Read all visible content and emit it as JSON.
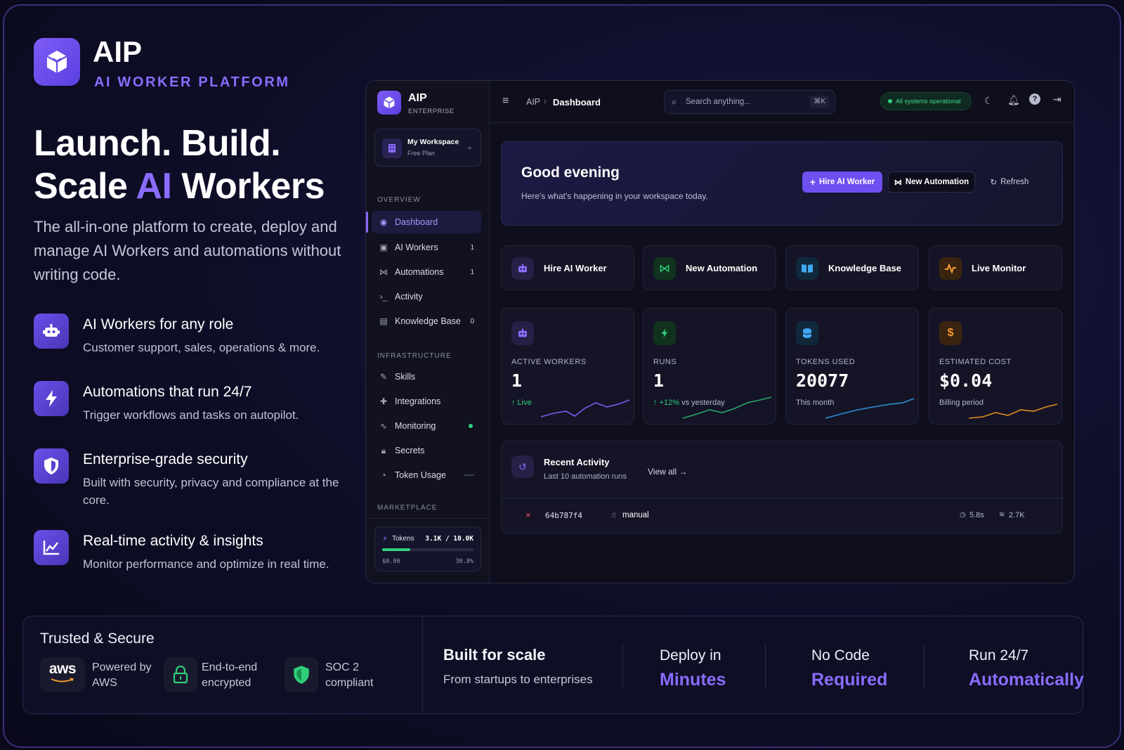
{
  "brand": {
    "name": "AIP",
    "subtitle": "AI WORKER PLATFORM"
  },
  "hero": {
    "line1": "Launch. Build.",
    "line2_pre": "Scale ",
    "line2_hl": "AI",
    "line2_post": " Workers",
    "lead": "The all-in-one platform to create, deploy and manage AI Workers and automations without writing code."
  },
  "features": [
    {
      "title": "AI Workers for any role",
      "desc": "Customer support, sales, operations & more.",
      "icon": "robot-icon"
    },
    {
      "title": "Automations that run 24/7",
      "desc": "Trigger workflows and tasks on autopilot.",
      "icon": "lightning-icon"
    },
    {
      "title": "Enterprise-grade security",
      "desc": "Built with security, privacy and compliance at the core.",
      "icon": "shield-icon"
    },
    {
      "title": "Real-time activity & insights",
      "desc": "Monitor performance and optimize in real time.",
      "icon": "chart-icon"
    }
  ],
  "dashboard": {
    "sidebar": {
      "app_name": "AIP",
      "app_tier": "ENTERPRISE",
      "workspace": {
        "name": "My Workspace",
        "plan": "Free Plan"
      },
      "sections": {
        "overview": "OVERVIEW",
        "infrastructure": "INFRASTRUCTURE",
        "marketplace": "MARKETPLACE"
      },
      "items": [
        {
          "label": "Dashboard",
          "badge": "",
          "active": true
        },
        {
          "label": "AI Workers",
          "badge": "1"
        },
        {
          "label": "Automations",
          "badge": "1"
        },
        {
          "label": "Activity",
          "badge": ""
        },
        {
          "label": "Knowledge Base",
          "badge": "0"
        },
        {
          "label": "Skills",
          "badge": ""
        },
        {
          "label": "Integrations",
          "badge": ""
        },
        {
          "label": "Monitoring",
          "badge": ""
        },
        {
          "label": "Secrets",
          "badge": ""
        },
        {
          "label": "Token Usage",
          "badge": ""
        }
      ],
      "tokens": {
        "label": "Tokens",
        "value": "3.1K / 10.0K",
        "cost": "$0.00",
        "percent": "30.8%",
        "fill": 0.308
      }
    },
    "topbar": {
      "breadcrumb_root": "AIP",
      "breadcrumb_current": "Dashboard",
      "search_placeholder": "Search anything...",
      "search_shortcut": "⌘K",
      "status": "All systems operational"
    },
    "welcome": {
      "greeting": "Good evening",
      "subtitle": "Here's what's happening in your workspace today.",
      "hire_button": "Hire AI Worker",
      "automation_button": "New Automation",
      "refresh_button": "Refresh"
    },
    "quick_actions": [
      {
        "label": "Hire AI Worker",
        "color": "#8b6cff"
      },
      {
        "label": "New Automation",
        "color": "#2fcf7a"
      },
      {
        "label": "Knowledge Base",
        "color": "#3fa7f0"
      },
      {
        "label": "Live Monitor",
        "color": "#f29a2e"
      }
    ],
    "stats": [
      {
        "label": "ACTIVE WORKERS",
        "value": "1",
        "sub_accent": "↑ Live",
        "sub": "",
        "color": "#8b6cff"
      },
      {
        "label": "RUNS",
        "value": "1",
        "sub_accent": "↑ +12%",
        "sub": "vs yesterday",
        "color": "#2fcf7a"
      },
      {
        "label": "TOKENS USED",
        "value": "20077",
        "sub_accent": "",
        "sub": "This month",
        "color": "#3fa7f0"
      },
      {
        "label": "ESTIMATED COST",
        "value": "$0.04",
        "sub_accent": "",
        "sub": "Billing period",
        "color": "#f29a2e"
      }
    ],
    "recent_activity": {
      "title": "Recent Activity",
      "subtitle": "Last 10 automation runs",
      "view_all": "View all",
      "rows": [
        {
          "status": "×",
          "id": "64b787f4",
          "trigger": "manual",
          "duration": "5.8s",
          "tokens": "2.7K"
        }
      ]
    }
  },
  "trust": {
    "title": "Trusted & Secure",
    "badges": [
      {
        "logo": "aws",
        "text1": "Powered by",
        "text2": "AWS"
      },
      {
        "text1": "End-to-end",
        "text2": "encrypted"
      },
      {
        "text1": "SOC 2",
        "text2": "compliant"
      }
    ],
    "scale_title": "Built for scale",
    "scale_sub": "From startups to enterprises",
    "claims": [
      {
        "top": "Deploy in",
        "bottom": "Minutes"
      },
      {
        "top": "No Code",
        "bottom": "Required"
      },
      {
        "top": "Run 24/7",
        "bottom": "Automatically"
      }
    ]
  },
  "colors": {
    "accent": "#8a6cff",
    "success": "#2fcf7a",
    "danger": "#ff4d5e"
  }
}
